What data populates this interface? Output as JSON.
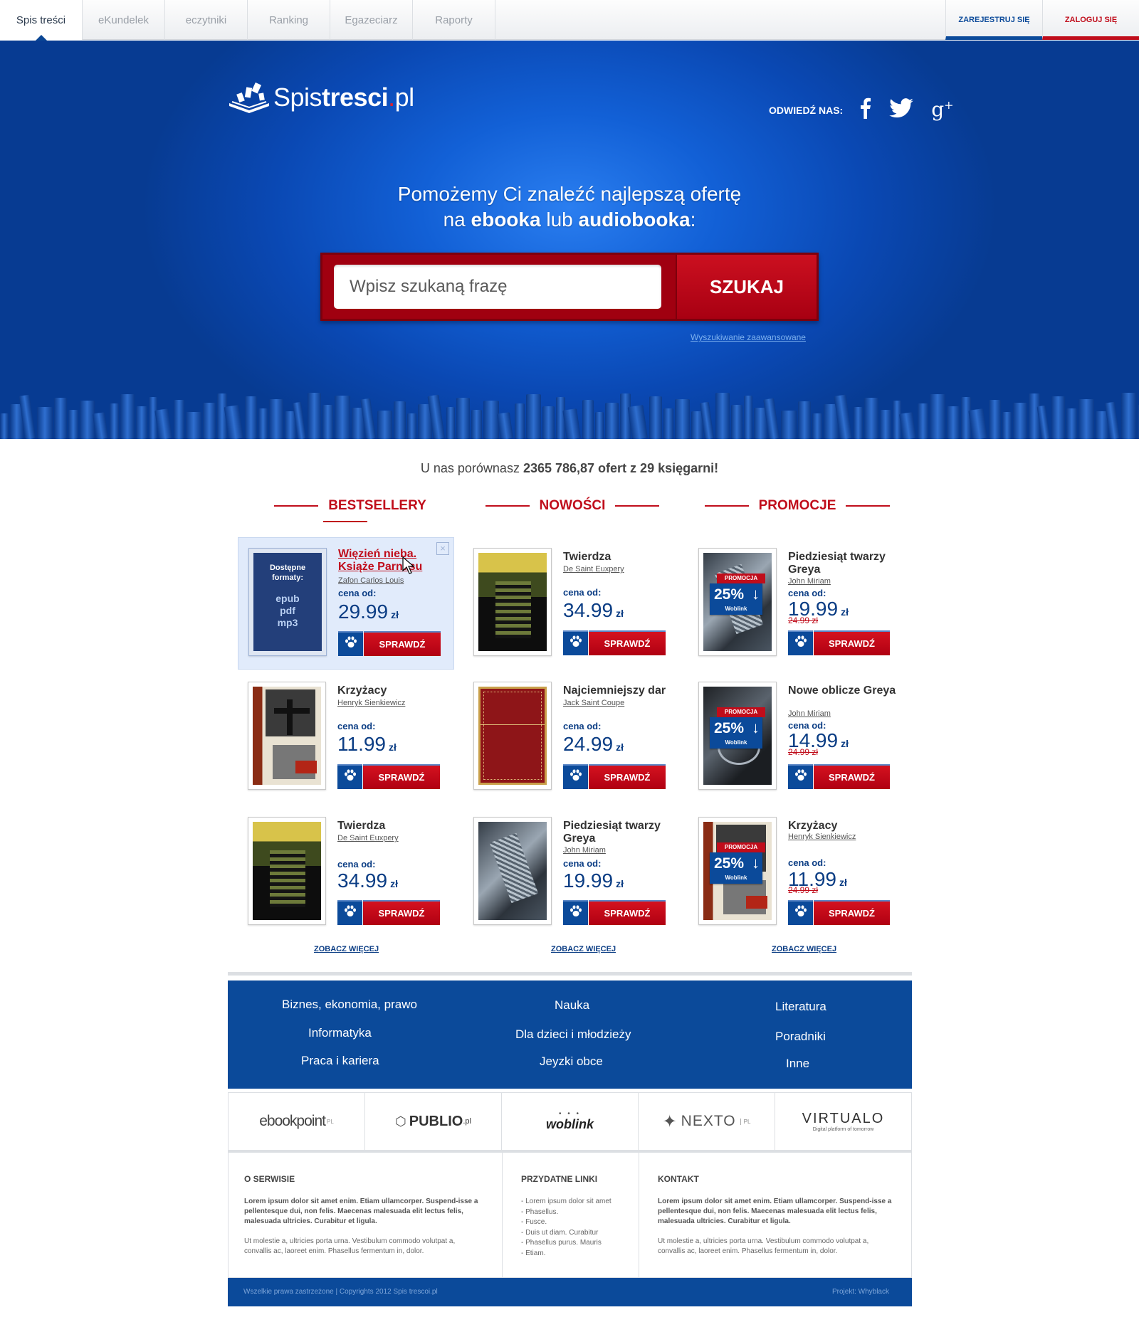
{
  "nav": {
    "tabs": [
      "Spis treści",
      "eKundelek",
      "eczytniki",
      "Ranking",
      "Egazeciarz",
      "Raporty"
    ],
    "register": "ZAREJESTRUJ SIĘ",
    "login": "ZALOGUJ SIĘ"
  },
  "header": {
    "logo_plain": "Spis",
    "logo_bold": "tresci",
    "logo_dot": ".",
    "logo_domain": "pl",
    "social_label": "ODWIEDŹ NAS:",
    "social_icons": [
      "facebook-icon",
      "twitter-icon",
      "google-plus-icon"
    ]
  },
  "hero": {
    "line1": "Pomożemy Ci znaleźć najlepszą ofertę",
    "line2_a": "na ",
    "line2_b": "ebooka",
    "line2_c": " lub ",
    "line2_d": "audiobooka",
    "line2_e": ":",
    "search_placeholder": "Wpisz szukaną frazę",
    "search_button": "SZUKAJ",
    "advanced": "Wyszukiwanie zaawansowane"
  },
  "stats": {
    "prefix": "U nas porównasz ",
    "value": "2365 786,87 ofert z 29 księgarni!"
  },
  "columns": {
    "bestsellery": "BESTSELLERY",
    "nowosci": "NOWOŚCI",
    "promocje": "PROMOCJE",
    "more": "ZOBACZ WIĘCEJ"
  },
  "labels": {
    "cena_od": "cena od:",
    "zl": "zł",
    "sprawdz": "SPRAWDŹ",
    "promocja": "PROMOCJA",
    "formats_label": "Dostępne formaty:",
    "formats": [
      "epub",
      "pdf",
      "mp3"
    ]
  },
  "books": {
    "b1": {
      "title": "Więzień nieba. Książe Parnasu",
      "author": "Zafon Carlos Louis",
      "price": "29.99"
    },
    "b2": {
      "title": "Krzyżacy",
      "author": "Henryk Sienkiewicz",
      "price": "11.99"
    },
    "b3": {
      "title": "Twierdza",
      "author": "De Saint Euxpery",
      "price": "34.99"
    },
    "n1": {
      "title": "Twierdza",
      "author": "De Saint Euxpery",
      "price": "34.99"
    },
    "n2": {
      "title": "Najciemniejszy dar",
      "author": "Jack Saint Coupe",
      "price": "24.99"
    },
    "n3": {
      "title": "Piedziesiąt twarzy Greya",
      "author": "John Miriam",
      "price": "19.99"
    },
    "p1": {
      "title": "Piedziesiąt twarzy Greya",
      "author": "John Miriam",
      "price": "19.99",
      "old": "24.99 zł",
      "discount": "25%",
      "shop": "Woblink"
    },
    "p2": {
      "title": "Nowe oblicze Greya",
      "author": "John Miriam",
      "price": "14.99",
      "old": "24.99 zł",
      "discount": "25%",
      "shop": "Woblink"
    },
    "p3": {
      "title": "Krzyżacy",
      "author": "Henryk Sienkiewicz",
      "price": "11.99",
      "old": "24.99 zł",
      "discount": "25%",
      "shop": "Woblink"
    }
  },
  "categories": {
    "c1": [
      "Biznes, ekonomia, prawo",
      "Informatyka",
      "Praca i kariera"
    ],
    "c2": [
      "Nauka",
      "Dla dzieci i młodzieży",
      "Jeyzki obce"
    ],
    "c3": [
      "Literatura",
      "Poradniki",
      "Inne"
    ]
  },
  "partners": [
    "ebookpoint",
    "PUBLIO",
    "woblink",
    "NEXTO",
    "VIRTUALO"
  ],
  "partner_suffix": {
    "ebookpoint": "PL",
    "publio": ".pl",
    "nexto": "PL",
    "virtualo": "Digital platform of tomorrow"
  },
  "footer": {
    "about_title": "O SERWISIE",
    "about_bold": "Lorem ipsum dolor sit amet enim. Etiam ullamcorper. Suspend-isse a pellentesque dui, non felis. Maecenas malesuada elit lectus felis, malesuada ultricies. Curabitur et ligula.",
    "about_text": "Ut molestie a, ultricies porta urna. Vestibulum commodo volutpat a, convallis ac, laoreet enim. Phasellus fermentum in, dolor.",
    "links_title": "PRZYDATNE LINKI",
    "links": [
      "- Lorem ipsum dolor sit amet",
      "- Phasellus.",
      "- Fusce.",
      "- Duis ut diam. Curabitur",
      "- Phasellus purus. Mauris",
      "- Etiam."
    ],
    "contact_title": "KONTAKT",
    "contact_bold": "Lorem ipsum dolor sit amet enim. Etiam ullamcorper. Suspend-isse a pellentesque dui, non felis. Maecenas malesuada elit lectus felis, malesuada ultricies. Curabitur et ligula.",
    "contact_text": "Ut molestie a, ultricies porta urna. Vestibulum commodo volutpat a, convallis ac, laoreet enim. Phasellus fermentum in, dolor.",
    "copyright": "Wszelkie prawa zastrzeżone | Copyrights 2012 Spis trescoi.pl",
    "project": "Projekt: Whyblack"
  },
  "colors": {
    "brand_blue": "#0b4a9a",
    "brand_red": "#c00d1b",
    "hero_light": "#2a7ef0"
  }
}
